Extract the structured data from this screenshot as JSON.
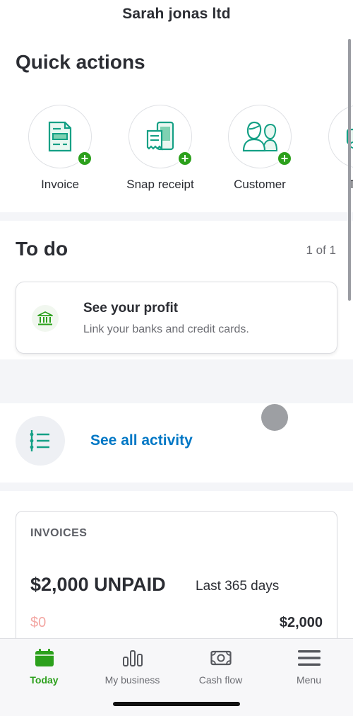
{
  "header": {
    "title": "Sarah jonas ltd"
  },
  "quick_actions": {
    "title": "Quick actions",
    "items": [
      {
        "label": "Invoice",
        "icon": "invoice-icon"
      },
      {
        "label": "Snap receipt",
        "icon": "receipt-icon"
      },
      {
        "label": "Customer",
        "icon": "customer-icon"
      },
      {
        "label": "Trac",
        "icon": "track-icon"
      }
    ]
  },
  "todo": {
    "title": "To do",
    "pager": "1 of 1",
    "card": {
      "title": "See your profit",
      "subtitle": "Link your banks and credit cards.",
      "icon": "bank-icon"
    }
  },
  "activity": {
    "link": "See all activity",
    "icon": "activity-list-icon"
  },
  "invoices": {
    "heading": "INVOICES",
    "amount": "$2,000 UNPAID",
    "period": "Last 365 days",
    "min_label": "$0",
    "max_label": "$2,000"
  },
  "bottom_nav": {
    "items": [
      {
        "label": "Today",
        "icon": "calendar-icon",
        "active": true
      },
      {
        "label": "My business",
        "icon": "bar-chart-icon",
        "active": false
      },
      {
        "label": "Cash flow",
        "icon": "cash-icon",
        "active": false
      },
      {
        "label": "Menu",
        "icon": "hamburger-icon",
        "active": false
      }
    ]
  },
  "colors": {
    "brand_green": "#2ca01c",
    "link_blue": "#0077c5",
    "icon_teal": "#14a085",
    "text_dark": "#2b2d33",
    "text_muted": "#6b6c72",
    "unpaid_pink": "#f3a7a3"
  }
}
